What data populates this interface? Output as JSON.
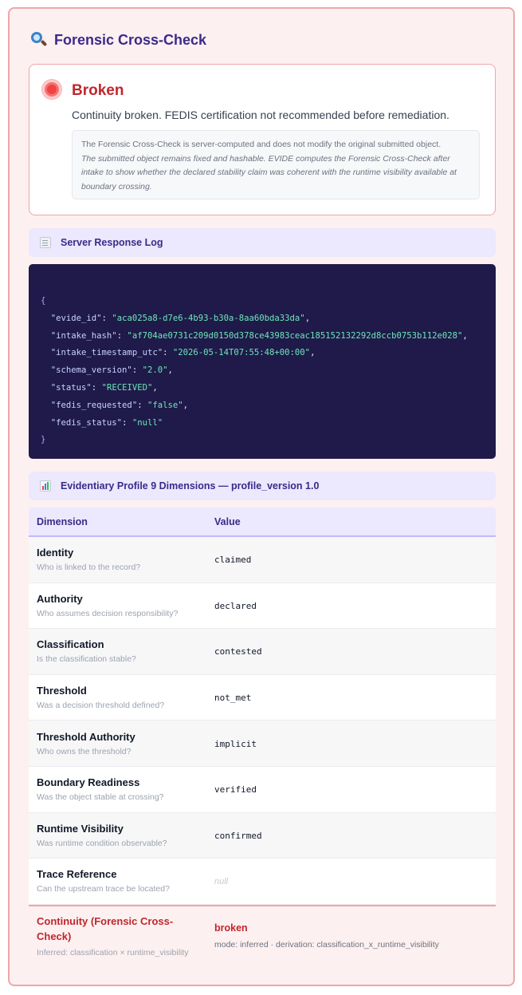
{
  "panel": {
    "title_icon": "magnifier-icon",
    "title": "Forensic Cross-Check"
  },
  "verdict": {
    "status_color": "#ef4444",
    "label": "Broken",
    "summary": "Continuity broken. FEDIS certification not recommended before remediation.",
    "note_line1": "The Forensic Cross-Check is server-computed and does not modify the original submitted object.",
    "note_line2": "The submitted object remains fixed and hashable. EVIDE computes the Forensic Cross-Check after intake to show whether the declared stability claim was coherent with the runtime visibility available at boundary crossing."
  },
  "log": {
    "icon": "document-icon",
    "title": "Server Response Log",
    "open_brace": "{",
    "close_brace": "}",
    "entries": [
      {
        "key": "\"evide_id\"",
        "value": "\"aca025a8-d7e6-4b93-b30a-8aa60bda33da\"",
        "sep": ","
      },
      {
        "key": "\"intake_hash\"",
        "value": "\"af704ae0731c209d0150d378ce43983ceac185152132292d8ccb0753b112e028\"",
        "sep": ","
      },
      {
        "key": "\"intake_timestamp_utc\"",
        "value": "\"2026-05-14T07:55:48+00:00\"",
        "sep": ","
      },
      {
        "key": "\"schema_version\"",
        "value": "\"2.0\"",
        "sep": ","
      },
      {
        "key": "\"status\"",
        "value": "\"RECEIVED\"",
        "sep": ","
      },
      {
        "key": "\"fedis_requested\"",
        "value": "\"false\"",
        "sep": ","
      },
      {
        "key": "\"fedis_status\"",
        "value": "\"null\"",
        "sep": ""
      }
    ]
  },
  "profile": {
    "icon": "bar-chart-icon",
    "title": "Evidentiary Profile 9 Dimensions — profile_version 1.0",
    "col_dimension": "Dimension",
    "col_value": "Value",
    "rows": [
      {
        "name": "Identity",
        "question": "Who is linked to the record?",
        "value": "claimed"
      },
      {
        "name": "Authority",
        "question": "Who assumes decision responsibility?",
        "value": "declared"
      },
      {
        "name": "Classification",
        "question": "Is the classification stable?",
        "value": "contested"
      },
      {
        "name": "Threshold",
        "question": "Was a decision threshold defined?",
        "value": "not_met"
      },
      {
        "name": "Threshold Authority",
        "question": "Who owns the threshold?",
        "value": "implicit"
      },
      {
        "name": "Boundary Readiness",
        "question": "Was the object stable at crossing?",
        "value": "verified"
      },
      {
        "name": "Runtime Visibility",
        "question": "Was runtime condition observable?",
        "value": "confirmed"
      },
      {
        "name": "Trace Reference",
        "question": "Can the upstream trace be located?",
        "value": "null"
      }
    ],
    "continuity": {
      "name": "Continuity (Forensic Cross-Check)",
      "question": "Inferred: classification × runtime_visibility",
      "value": "broken",
      "mode": "mode: inferred · derivation: classification_x_runtime_visibility",
      "color": "#c0262d"
    }
  }
}
